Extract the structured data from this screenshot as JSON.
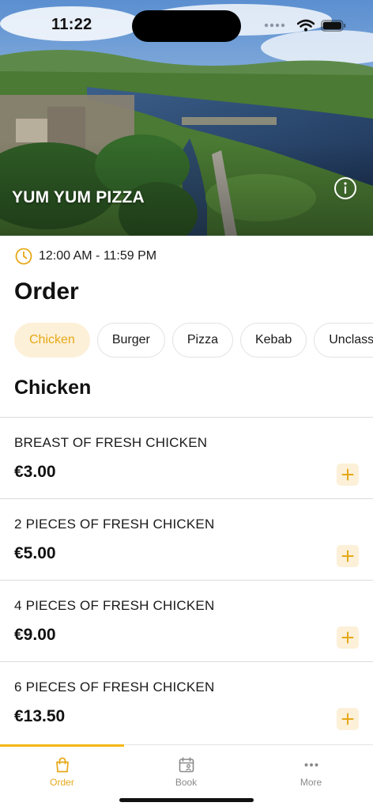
{
  "status_bar": {
    "time": "11:22"
  },
  "restaurant": {
    "name": "YUM YUM PIZZA",
    "hours": "12:00 AM - 11:59 PM"
  },
  "page": {
    "title": "Order"
  },
  "categories": [
    {
      "label": "Chicken",
      "active": true
    },
    {
      "label": "Burger",
      "active": false
    },
    {
      "label": "Pizza",
      "active": false
    },
    {
      "label": "Kebab",
      "active": false
    },
    {
      "label": "Unclassified",
      "active": false
    }
  ],
  "section": {
    "title": "Chicken"
  },
  "items": [
    {
      "name": "BREAST OF FRESH CHICKEN",
      "price": "€3.00"
    },
    {
      "name": "2 PIECES OF FRESH CHICKEN",
      "price": "€5.00"
    },
    {
      "name": "4 PIECES OF FRESH CHICKEN",
      "price": "€9.00"
    },
    {
      "name": "6 PIECES OF FRESH CHICKEN",
      "price": "€13.50"
    }
  ],
  "tabbar": {
    "order": {
      "label": "Order",
      "icon": "bag-icon"
    },
    "book": {
      "label": "Book",
      "icon": "calendar-user-icon"
    },
    "more": {
      "label": "More",
      "icon": "more-dots-icon"
    }
  },
  "colors": {
    "accent": "#f2b814",
    "accent_text": "#e6a817",
    "accent_bg": "#fcf0d8"
  }
}
